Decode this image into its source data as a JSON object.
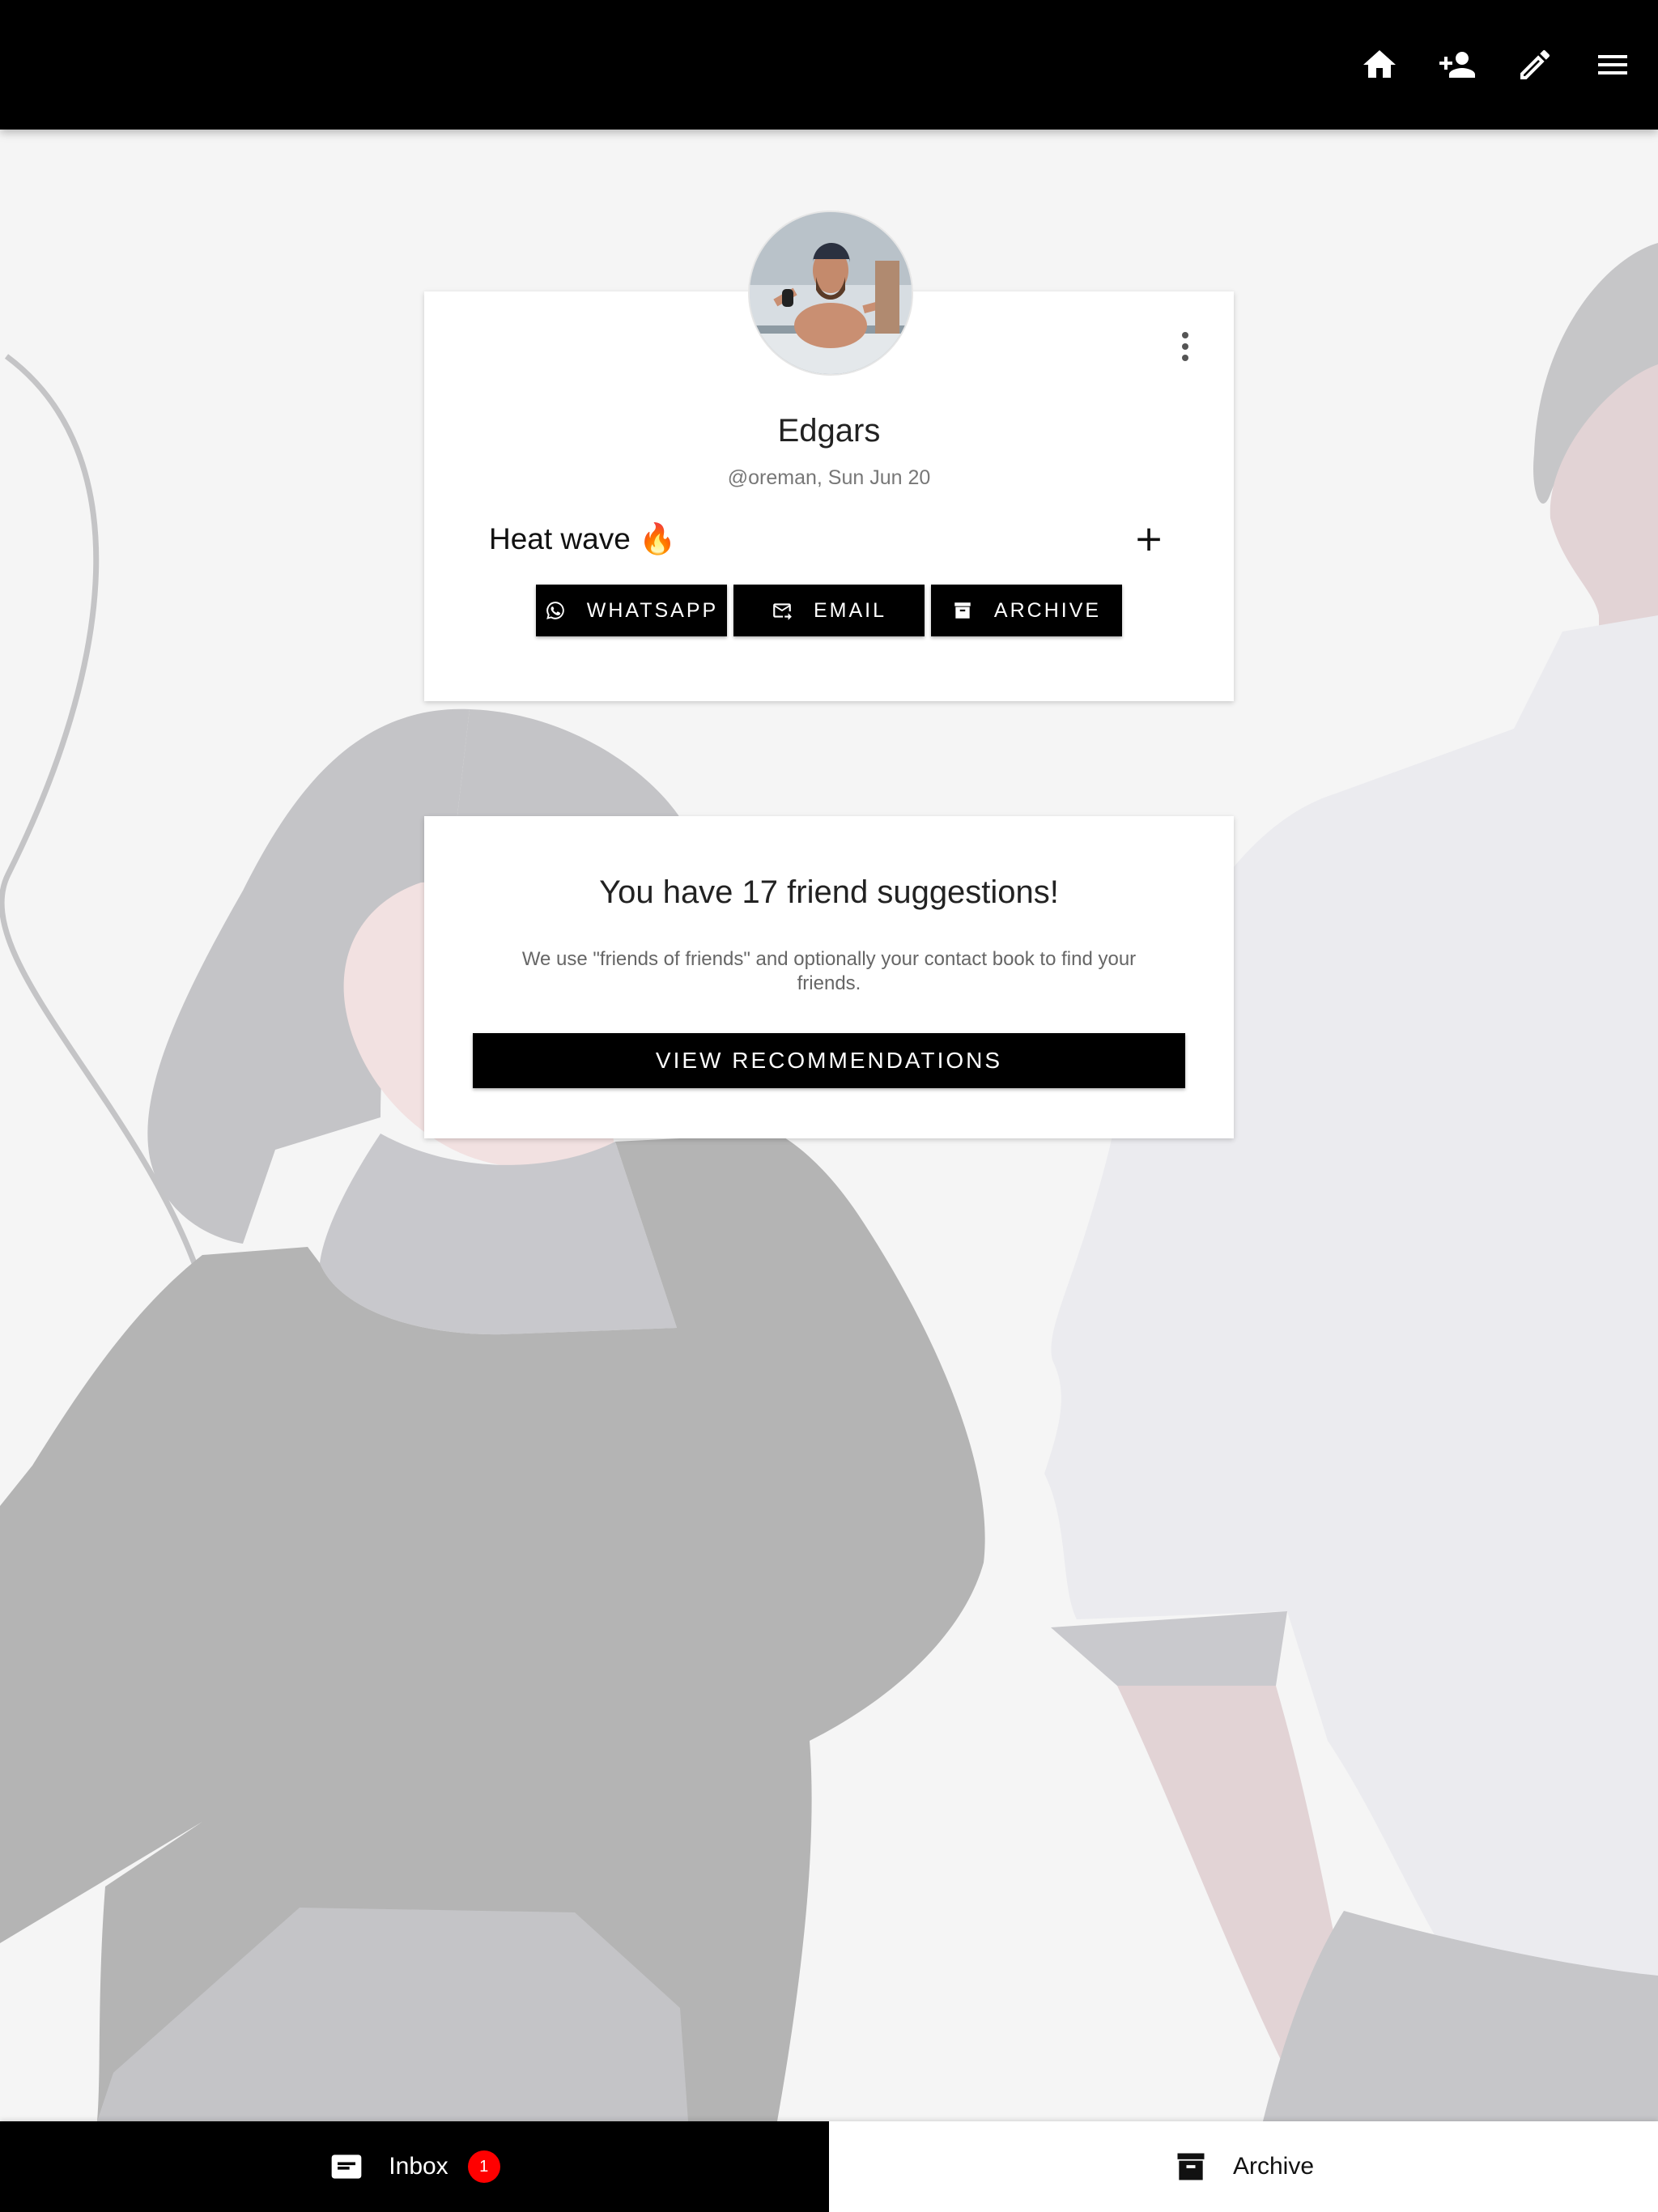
{
  "topbar": {
    "icons": [
      "home-icon",
      "add-person-icon",
      "edit-icon",
      "menu-icon"
    ]
  },
  "profile": {
    "name": "Edgars",
    "meta": "@oreman, Sun Jun 20",
    "status": "Heat wave 🔥",
    "add_label": "+",
    "actions": [
      {
        "label": "WHATSAPP",
        "icon": "whatsapp-icon"
      },
      {
        "label": "EMAIL",
        "icon": "email-icon"
      },
      {
        "label": "ARCHIVE",
        "icon": "archive-icon"
      }
    ]
  },
  "suggestions": {
    "title": "You have 17 friend suggestions!",
    "description": "We use \"friends of friends\" and optionally your contact book to find your friends.",
    "button_label": "VIEW RECOMMENDATIONS"
  },
  "bottom_nav": {
    "tabs": [
      {
        "label": "Inbox",
        "icon": "inbox-icon",
        "badge": "1",
        "active": true
      },
      {
        "label": "Archive",
        "icon": "archive-icon",
        "active": false
      }
    ]
  },
  "colors": {
    "accent": "#000000",
    "badge": "#ff0000",
    "background": "#f5f5f5"
  }
}
